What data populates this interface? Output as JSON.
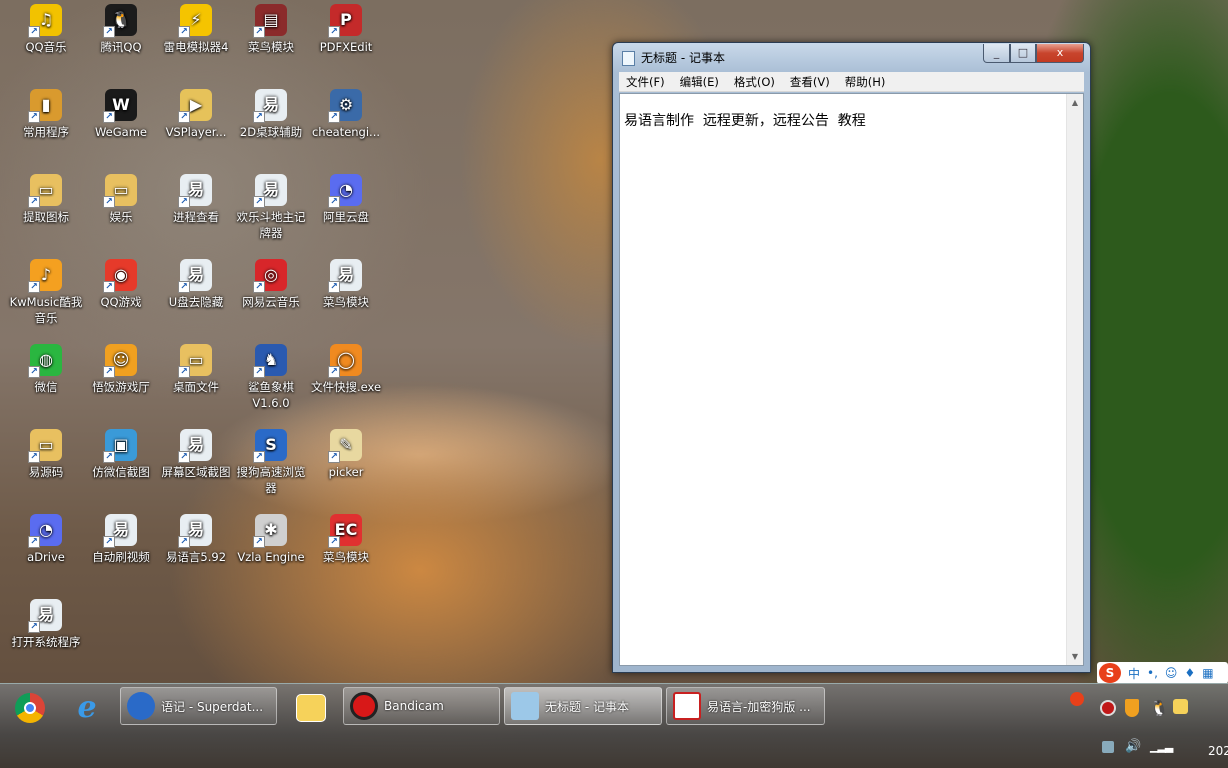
{
  "desktop": {
    "icons": [
      {
        "label": "QQ音乐",
        "color": "#f2c200",
        "glyph": "♫"
      },
      {
        "label": "腾讯QQ",
        "color": "#1c1c1c",
        "glyph": "🐧"
      },
      {
        "label": "雷电模拟器4",
        "color": "#f5c400",
        "glyph": "⚡"
      },
      {
        "label": "菜鸟模块",
        "color": "#8b2b2b",
        "glyph": "▤"
      },
      {
        "label": "PDFXEdit",
        "color": "#c42a2a",
        "glyph": "P"
      },
      {
        "label": "常用程序",
        "color": "#d99a2e",
        "glyph": "▮"
      },
      {
        "label": "WeGame",
        "color": "#1a1a1a",
        "glyph": "W"
      },
      {
        "label": "VSPlayer...",
        "color": "#e6c25a",
        "glyph": "▶"
      },
      {
        "label": "2D桌球辅助",
        "color": "#e8eef2",
        "glyph": "易"
      },
      {
        "label": "cheatengi...",
        "color": "#3a6aa8",
        "glyph": "⚙"
      },
      {
        "label": "提取图标",
        "color": "#e8c060",
        "glyph": "▭"
      },
      {
        "label": "娱乐",
        "color": "#e8c060",
        "glyph": "▭"
      },
      {
        "label": "进程查看",
        "color": "#e8eef2",
        "glyph": "易"
      },
      {
        "label": "欢乐斗地主记牌器",
        "color": "#e8eef2",
        "glyph": "易"
      },
      {
        "label": "阿里云盘",
        "color": "#5a6cf0",
        "glyph": "◔"
      },
      {
        "label": "KwMusic酷我音乐",
        "color": "#f4a020",
        "glyph": "♪"
      },
      {
        "label": "QQ游戏",
        "color": "#e63a2a",
        "glyph": "◉"
      },
      {
        "label": "U盘去隐藏",
        "color": "#e8eef2",
        "glyph": "易"
      },
      {
        "label": "网易云音乐",
        "color": "#d8262a",
        "glyph": "◎"
      },
      {
        "label": "菜鸟模块",
        "color": "#e8eef2",
        "glyph": "易"
      },
      {
        "label": "微信",
        "color": "#2ab640",
        "glyph": "◍"
      },
      {
        "label": "悟饭游戏厅",
        "color": "#f0a020",
        "glyph": "☺"
      },
      {
        "label": "桌面文件",
        "color": "#e8c060",
        "glyph": "▭"
      },
      {
        "label": "鲨鱼象棋V1.6.0",
        "color": "#2a5ab0",
        "glyph": "♞"
      },
      {
        "label": "文件快搜.exe",
        "color": "#f08a20",
        "glyph": "◯"
      },
      {
        "label": "易源码",
        "color": "#e8c060",
        "glyph": "▭"
      },
      {
        "label": "仿微信截图",
        "color": "#3a9ad8",
        "glyph": "▣"
      },
      {
        "label": "屏幕区域截图",
        "color": "#e8eef2",
        "glyph": "易"
      },
      {
        "label": "搜狗高速浏览器",
        "color": "#2a6ac8",
        "glyph": "S"
      },
      {
        "label": "picker",
        "color": "#e8d8a0",
        "glyph": "✎"
      },
      {
        "label": "aDrive",
        "color": "#5a6cf0",
        "glyph": "◔"
      },
      {
        "label": "自动刷视频",
        "color": "#e8eef2",
        "glyph": "易"
      },
      {
        "label": "易语言5.92",
        "color": "#e8eef2",
        "glyph": "易"
      },
      {
        "label": "Vzla Engine",
        "color": "#d0d0d0",
        "glyph": "✱"
      },
      {
        "label": "菜鸟模块",
        "color": "#e03030",
        "glyph": "EC"
      },
      {
        "label": "打开系统程序",
        "color": "#e8eef2",
        "glyph": "易"
      }
    ]
  },
  "notepad": {
    "title": "无标题 - 记事本",
    "menu": [
      "文件(F)",
      "编辑(E)",
      "格式(O)",
      "查看(V)",
      "帮助(H)"
    ],
    "content": "易语言制作  远程更新，远程公告  教程",
    "close_glyph": "x",
    "min_glyph": "_",
    "max_glyph": "□"
  },
  "taskbar": {
    "tasks": [
      {
        "label": "语记 - Superdat...",
        "color": "#2a6ac8"
      },
      {
        "label": "Bandicam",
        "color": "#d81818"
      },
      {
        "label": "无标题 - 记事本",
        "color": "#9cc8e8"
      },
      {
        "label": "易语言-加密狗版 ...",
        "color": "#c82020"
      }
    ],
    "ime_label": "中",
    "clock_partial": "202"
  }
}
